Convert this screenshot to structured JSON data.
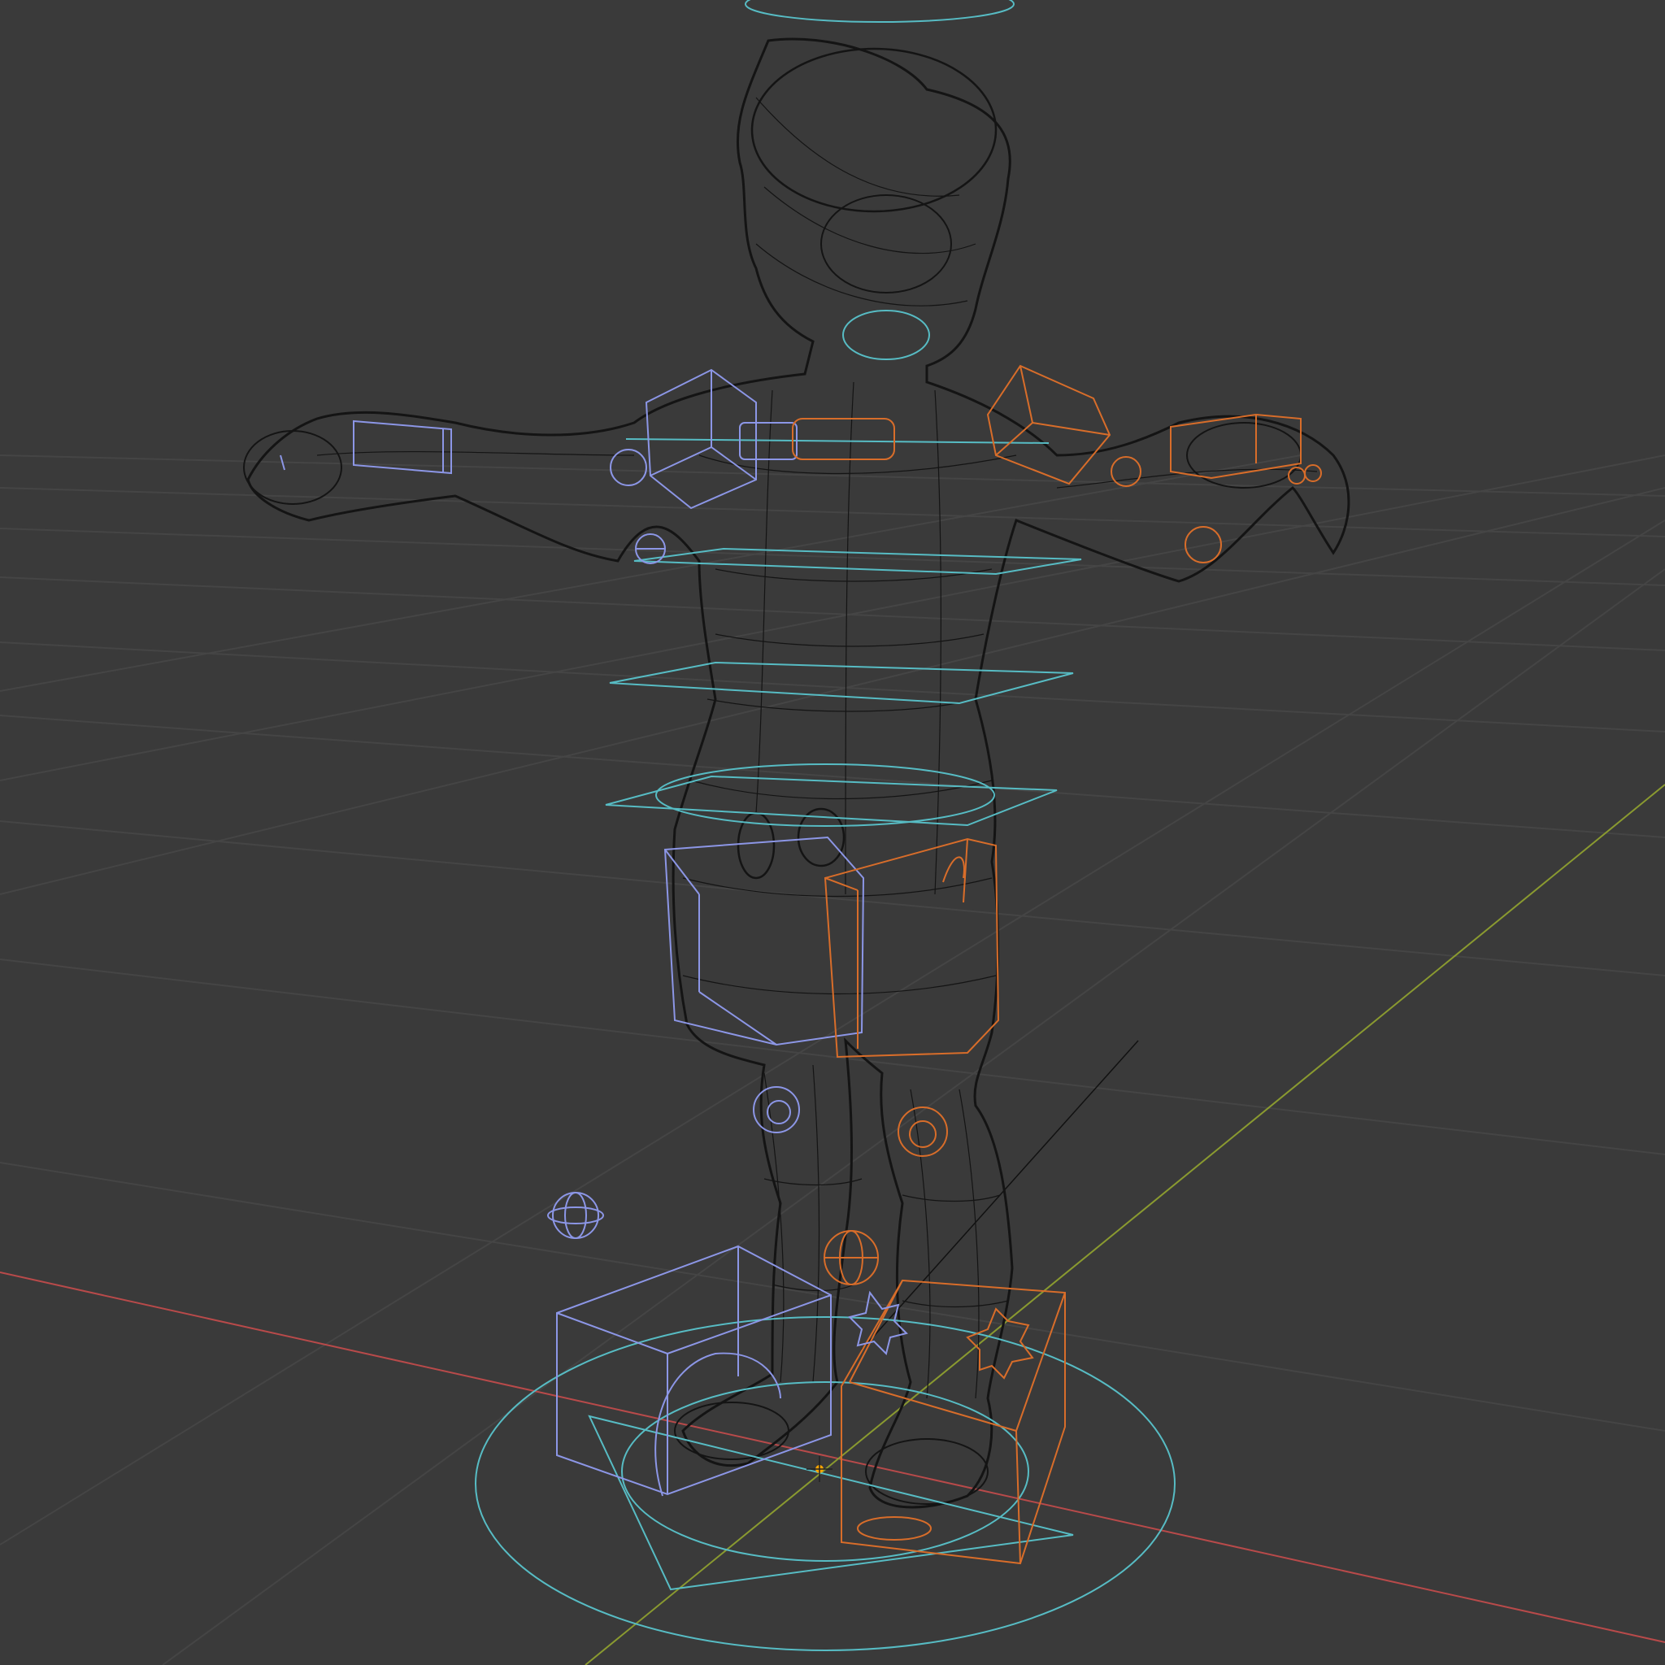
{
  "viewport": {
    "background": "#3a3a3a",
    "display_mode": "wireframe",
    "colors": {
      "grid": "#454545",
      "x_axis": "#b84a4a",
      "y_axis": "#8a9a30",
      "mesh": "#141414",
      "center_controls": "#57bcc4",
      "left_controls": "#8c96e6",
      "right_controls": "#d86d2a",
      "origin": "#ffa500"
    },
    "icons": [
      "origin-icon",
      "knee-pole-icon",
      "foot-pivot-icon"
    ]
  }
}
